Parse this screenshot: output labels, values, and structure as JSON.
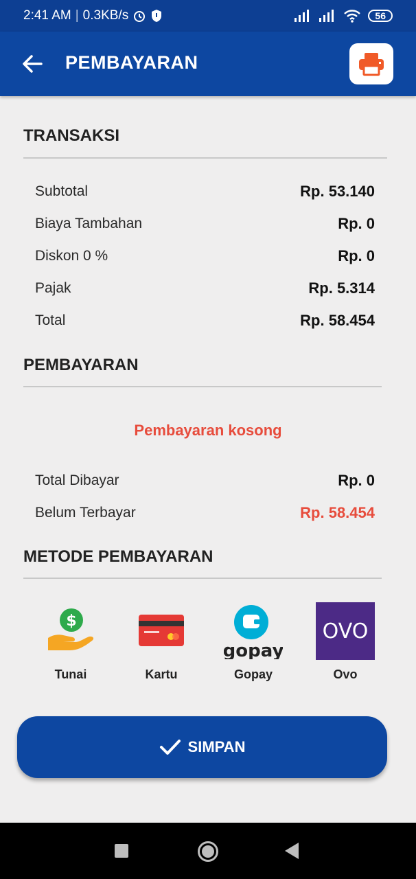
{
  "status_bar": {
    "time": "2:41 AM",
    "speed": "0.3KB/s",
    "battery": "56"
  },
  "app_bar": {
    "title": "PEMBAYARAN",
    "icons": [
      "back-arrow-icon",
      "printer-icon"
    ]
  },
  "transaksi": {
    "title": "TRANSAKSI",
    "rows": [
      {
        "label": "Subtotal",
        "value": "Rp. 53.140"
      },
      {
        "label": "Biaya Tambahan",
        "value": "Rp. 0"
      },
      {
        "label": "Diskon 0 %",
        "value": "Rp. 0"
      },
      {
        "label": "Pajak",
        "value": "Rp. 5.314"
      },
      {
        "label": "Total",
        "value": "Rp. 58.454"
      }
    ]
  },
  "pembayaran": {
    "title": "PEMBAYARAN",
    "empty_message": "Pembayaran kosong",
    "rows": [
      {
        "label": "Total Dibayar",
        "value": "Rp. 0"
      },
      {
        "label": "Belum Terbayar",
        "value": "Rp. 58.454"
      }
    ]
  },
  "metode": {
    "title": "METODE PEMBAYARAN",
    "items": [
      {
        "label": "Tunai",
        "icon": "cash-hand-icon"
      },
      {
        "label": "Kartu",
        "icon": "credit-card-icon"
      },
      {
        "label": "Gopay",
        "icon": "gopay-logo",
        "logo_text": "gopay"
      },
      {
        "label": "Ovo",
        "icon": "ovo-logo",
        "logo_text": "OVO"
      }
    ]
  },
  "save_button": {
    "label": "SIMPAN",
    "icon": "check-icon"
  },
  "colors": {
    "primary": "#0d47a1",
    "accent_orange": "#f05a28",
    "error_red": "#e74c3c",
    "ovo_purple": "#4c2a86",
    "gopay_blue": "#00aed6"
  }
}
